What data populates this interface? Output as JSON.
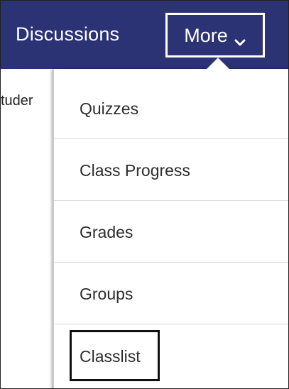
{
  "navbar": {
    "background": "#2b3375",
    "discussions_label": "Discussions",
    "more_label": "More",
    "more_icon": "chevron-down-icon"
  },
  "content": {
    "partial_text": "tuder"
  },
  "dropdown": {
    "items": [
      {
        "label": "Quizzes"
      },
      {
        "label": "Class Progress"
      },
      {
        "label": "Grades"
      },
      {
        "label": "Groups"
      },
      {
        "label": "Classlist",
        "highlighted": true
      }
    ]
  }
}
